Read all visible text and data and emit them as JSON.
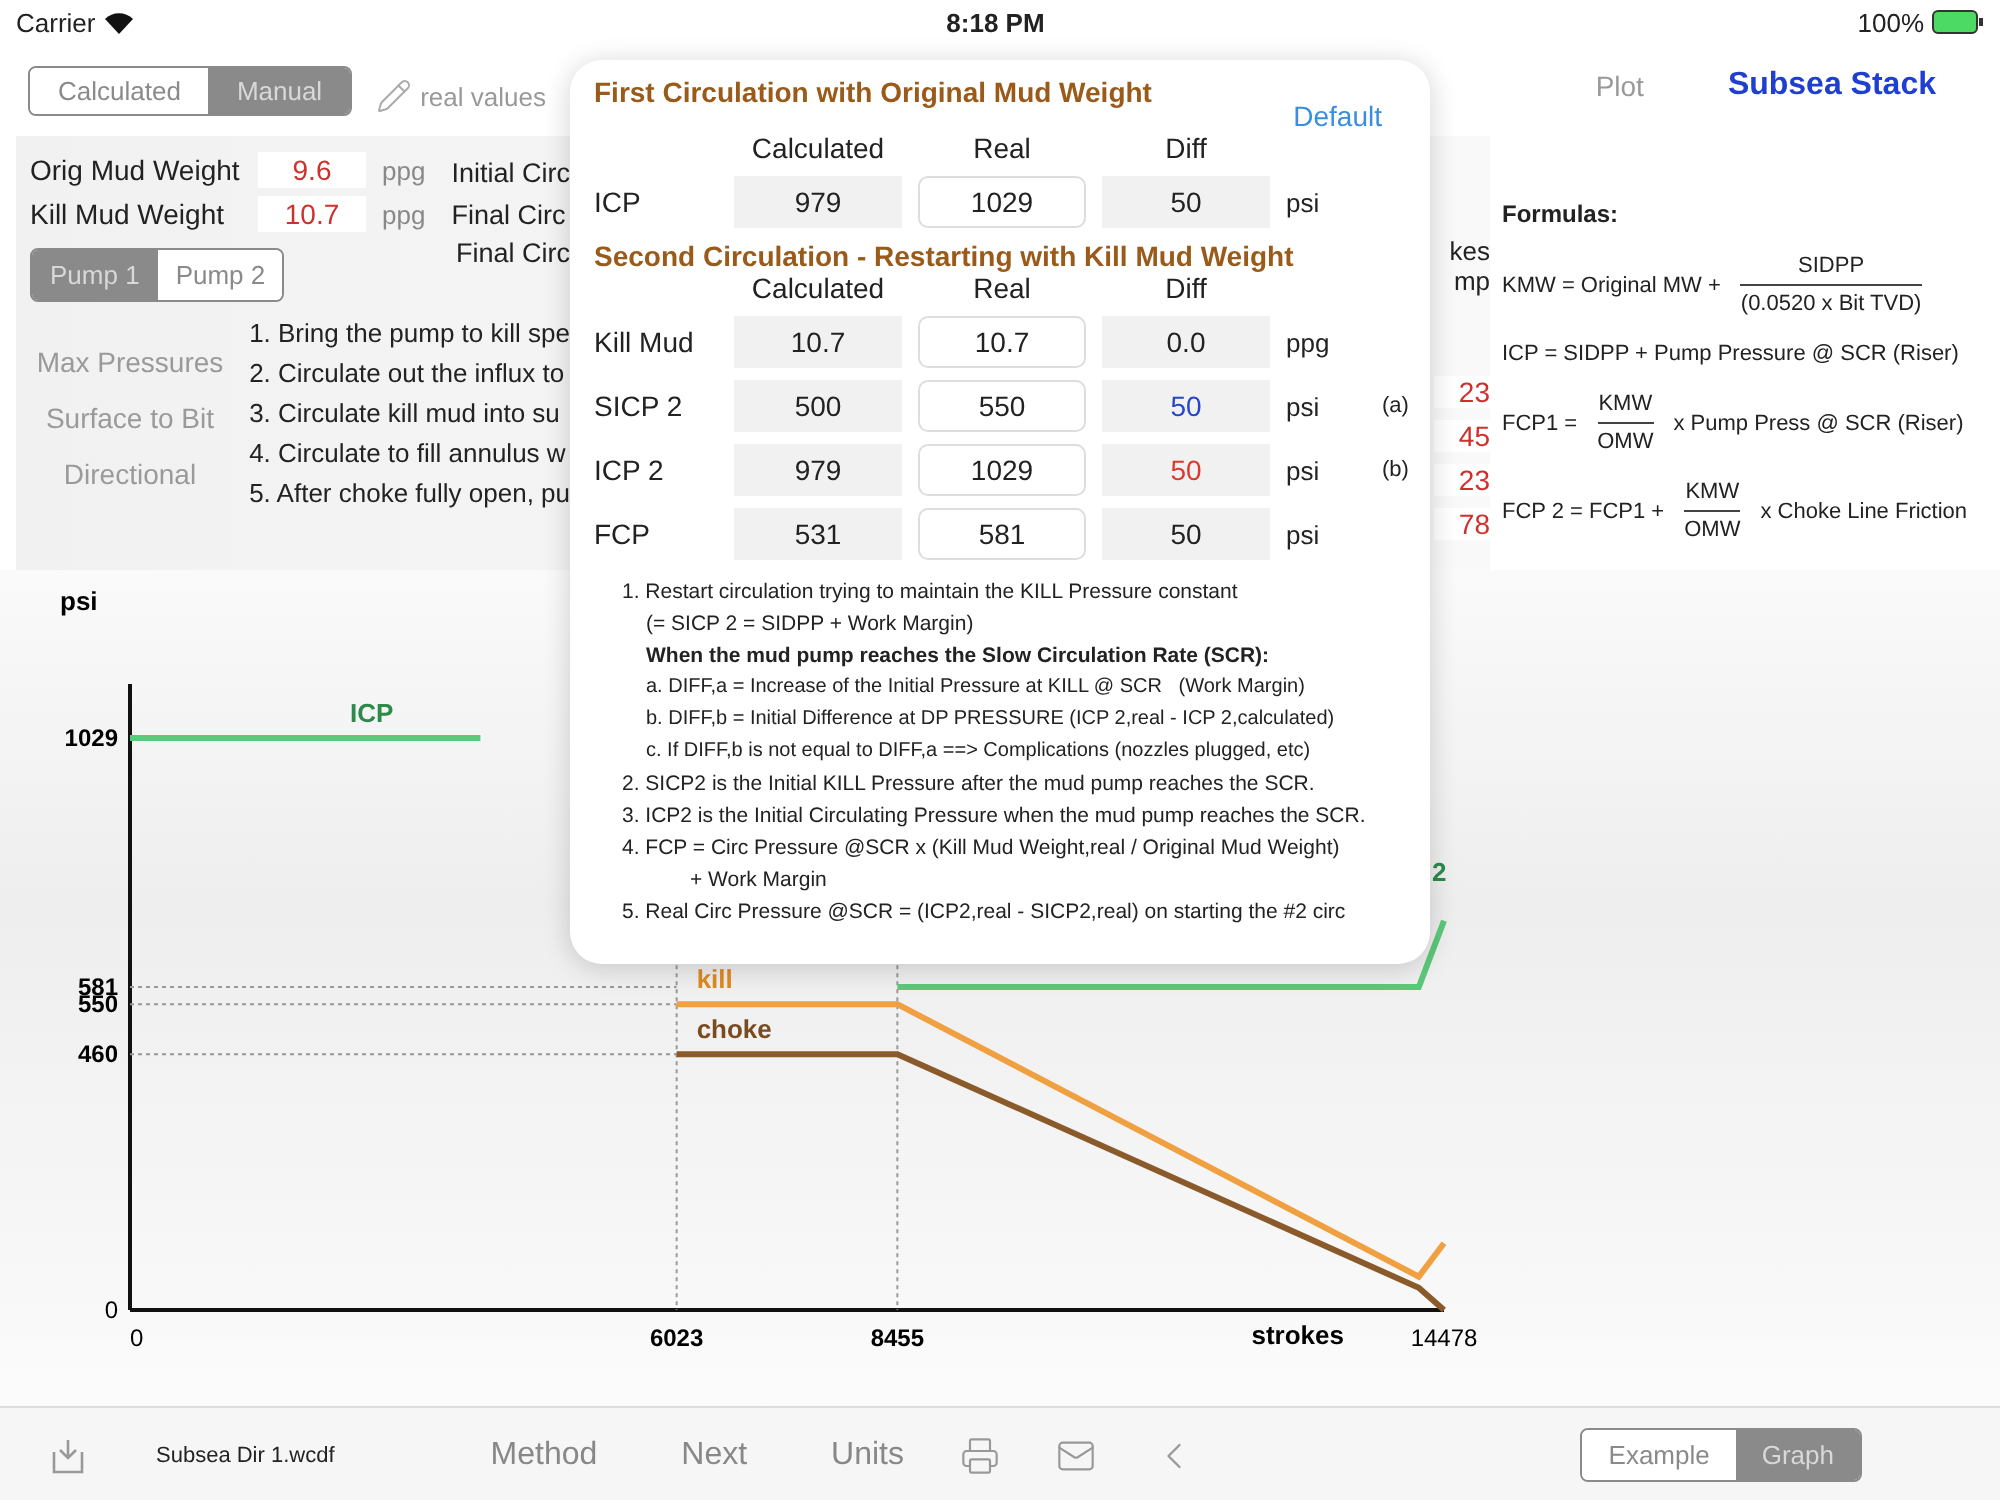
{
  "status_bar": {
    "carrier": "Carrier",
    "time": "8:18 PM",
    "battery": "100%"
  },
  "mode_switch": [
    {
      "label": "Calculated",
      "selected": false
    },
    {
      "label": "Manual",
      "selected": true
    }
  ],
  "real_values_label": "real values",
  "nav": {
    "plot": "Plot",
    "title": "Subsea Stack"
  },
  "mud_weights": [
    {
      "label": "Orig Mud Weight",
      "value": "9.6",
      "unit": "ppg"
    },
    {
      "label": "Kill Mud Weight",
      "value": "10.7",
      "unit": "ppg"
    }
  ],
  "circ_labels": [
    "Initial Circ",
    "Final Circ",
    "Final Circ"
  ],
  "pump_switch": [
    {
      "label": "Pump 1",
      "selected": true
    },
    {
      "label": "Pump 2",
      "selected": false
    }
  ],
  "side_links": [
    "Max Pressures",
    "Surface to Bit",
    "Directional"
  ],
  "steps": [
    "1. Bring the pump to kill spe",
    "2. Circulate out the influx to",
    "3. Circulate kill mud into su",
    "4. Circulate to fill annulus w",
    "5. After choke fully open, pu"
  ],
  "strokes_header": [
    "kes",
    "mp"
  ],
  "strokes_values": [
    "23",
    "45",
    "23",
    "78"
  ],
  "formulas": {
    "title": "Formulas:",
    "items": [
      {
        "kind": "fraction",
        "lhs": "KMW = Original MW +",
        "numerator": "SIDPP",
        "denominator": "(0.0520 x Bit TVD)"
      },
      {
        "kind": "plain",
        "text": "ICP = SIDPP + Pump Pressure @ SCR (Riser)"
      },
      {
        "kind": "fraction",
        "lhs": "FCP1 =",
        "numerator": "KMW",
        "denominator": "OMW",
        "rhs": "x Pump Press @ SCR (Riser)"
      },
      {
        "kind": "fraction",
        "lhs": "FCP 2 = FCP1 +",
        "numerator": "KMW",
        "denominator": "OMW",
        "rhs": "x Choke Line Friction"
      }
    ]
  },
  "popover": {
    "default_button": "Default",
    "sections": [
      {
        "title": "First Circulation with Original Mud Weight",
        "headers": [
          "Calculated",
          "Real",
          "Diff"
        ],
        "rows": [
          {
            "label": "ICP",
            "calculated": "979",
            "real": "1029",
            "diff": "50",
            "unit": "psi",
            "color": "#222222"
          }
        ]
      },
      {
        "title": "Second Circulation - Restarting with Kill Mud Weight",
        "headers": [
          "Calculated",
          "Real",
          "Diff"
        ],
        "rows": [
          {
            "label": "Kill Mud",
            "calculated": "10.7",
            "real": "10.7",
            "diff": "0.0",
            "unit": "ppg",
            "color": "#222222"
          },
          {
            "label": "SICP 2",
            "calculated": "500",
            "real": "550",
            "diff": "50",
            "unit": "psi",
            "note": "(a)",
            "color": "#2546c8"
          },
          {
            "label": "ICP 2",
            "calculated": "979",
            "real": "1029",
            "diff": "50",
            "unit": "psi",
            "note": "(b)",
            "color": "#d93a2e"
          },
          {
            "label": "FCP",
            "calculated": "531",
            "real": "581",
            "diff": "50",
            "unit": "psi",
            "color": "#222222"
          }
        ]
      }
    ],
    "notes": [
      {
        "text": "1. Restart circulation trying to maintain the KILL Pressure constant",
        "continuation": "(= SICP 2 = SIDPP + Work Margin)",
        "subheading": "When the mud pump reaches the Slow Circulation Rate (SCR):",
        "children": [
          {
            "text": "a. DIFF,a = Increase of the Initial Pressure at KILL @ SCR   (Work Margin)"
          },
          {
            "text": "b. DIFF,b = Initial Difference at DP PRESSURE (ICP 2,real - ICP 2,calculated)"
          },
          {
            "text": "c. If DIFF,b is not equal to DIFF,a ==> Complications (nozzles plugged, etc)"
          }
        ]
      },
      {
        "text": "2. SICP2 is the Initial KILL Pressure after the mud pump reaches the SCR."
      },
      {
        "text": "3. ICP2 is the Initial Circulating Pressure when the mud pump reaches the SCR."
      },
      {
        "text": "4. FCP = Circ Pressure @SCR x (Kill Mud Weight,real / Original Mud Weight)",
        "continuation": "+ Work Margin"
      },
      {
        "text": "5. Real Circ Pressure @SCR = (ICP2,real - SICP2,real) on starting the #2 circ"
      }
    ]
  },
  "chart": {
    "chart_data": {
      "type": "line",
      "ylabel": "psi",
      "xlabel": "strokes",
      "x": [
        0,
        3860,
        6023,
        8455,
        14200,
        14478
      ],
      "series": [
        {
          "name": "ICP",
          "color": "#5cc97a",
          "values": [
            1029,
            1029,
            null,
            581,
            581,
            700
          ]
        },
        {
          "name": "kill",
          "color": "#f0a040",
          "values": [
            null,
            null,
            550,
            550,
            60,
            120
          ]
        },
        {
          "name": "choke",
          "color": "#8b5a2b",
          "values": [
            null,
            null,
            460,
            460,
            40,
            0
          ]
        }
      ],
      "xlim": [
        0,
        14478
      ],
      "ylim": [
        0,
        1126
      ],
      "xticks": [
        0,
        6023,
        8455,
        14478
      ],
      "yticks": [
        0,
        460,
        550,
        581,
        1029
      ],
      "ref_lines": [
        {
          "axis": "x",
          "value": 6023
        },
        {
          "axis": "x",
          "value": 8455
        }
      ],
      "annotations": [
        "2"
      ]
    }
  },
  "toolbar": {
    "filename": "Subsea Dir 1.wcdf",
    "buttons": [
      "Method",
      "Next",
      "Units"
    ],
    "segment": [
      {
        "label": "Example",
        "selected": false
      },
      {
        "label": "Graph",
        "selected": true
      }
    ]
  }
}
